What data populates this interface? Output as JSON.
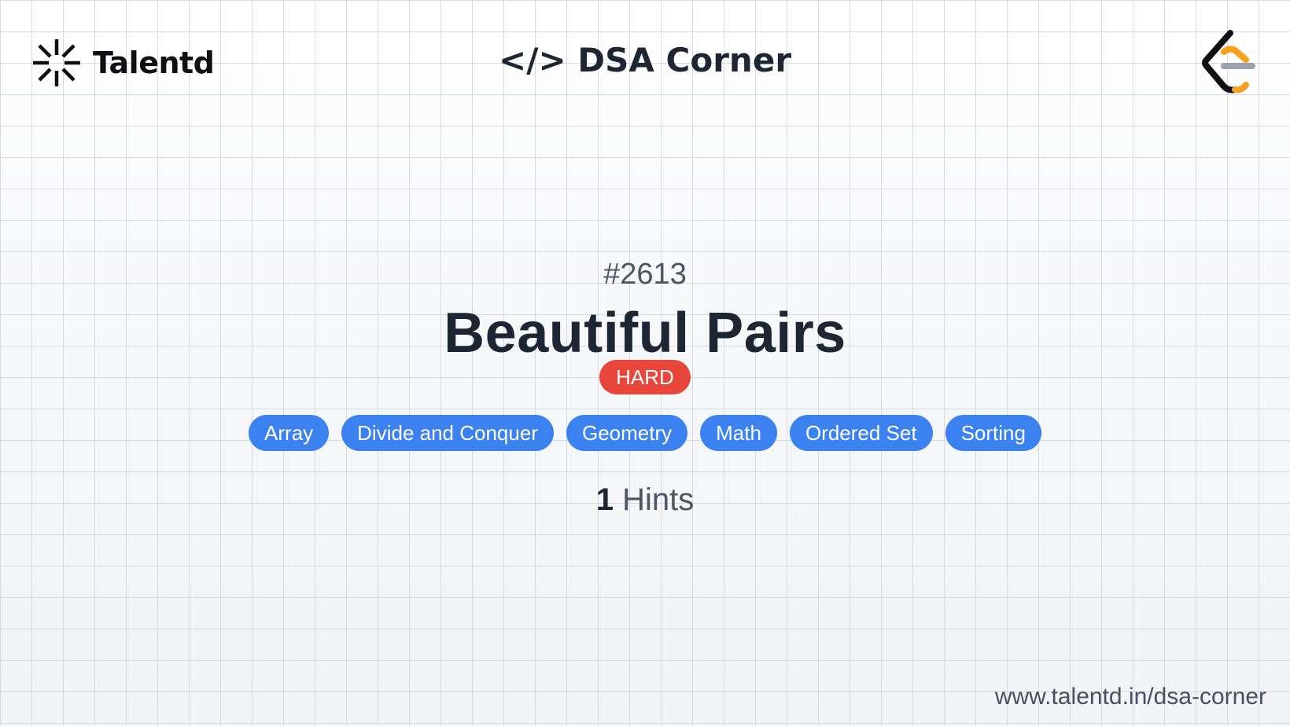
{
  "header": {
    "brand_name": "Talentd",
    "title": "</> DSA Corner"
  },
  "problem": {
    "number": "#2613",
    "title": "Beautiful Pairs",
    "difficulty": "HARD",
    "tags": [
      "Array",
      "Divide and Conquer",
      "Geometry",
      "Math",
      "Ordered Set",
      "Sorting"
    ],
    "hints_count": "1",
    "hints_label": "Hints"
  },
  "footer": {
    "url": "www.talentd.in/dsa-corner"
  },
  "colors": {
    "difficulty_hard": "#e8463a",
    "tag_blue": "#3b82f0",
    "title_dark": "#1e2634",
    "leetcode_orange": "#f89f1b"
  },
  "icons": {
    "brand": "talentd-spark-icon",
    "platform": "leetcode-logo-icon"
  }
}
